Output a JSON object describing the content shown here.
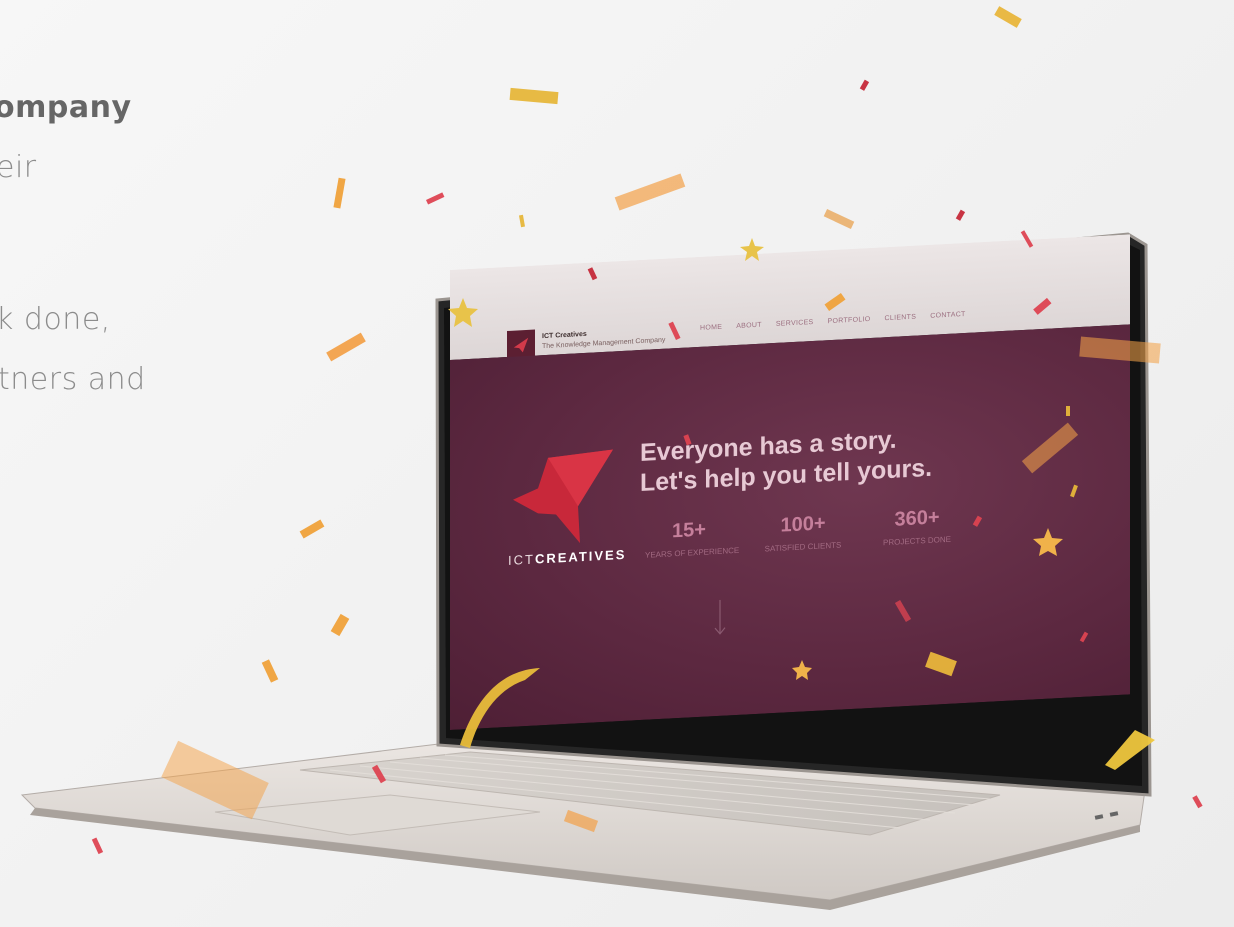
{
  "side_copy": {
    "line1": "ompany",
    "line2": "eir",
    "line3": "k done,",
    "line4": "tners and"
  },
  "laptop_screen": {
    "site": {
      "brand_name": "ICT Creatives",
      "tagline": "The Knowledge Management Company",
      "nav": [
        {
          "label": "HOME"
        },
        {
          "label": "ABOUT"
        },
        {
          "label": "SERVICES"
        },
        {
          "label": "PORTFOLIO"
        },
        {
          "label": "CLIENTS"
        },
        {
          "label": "CONTACT"
        }
      ],
      "hero": {
        "logo_text_light": "ICT",
        "logo_text_bold": "CREATIVES",
        "headline_line1": "Everyone has a story.",
        "headline_line2": "Let's help you tell yours.",
        "stats": [
          {
            "value": "15+",
            "label": "YEARS OF EXPERIENCE"
          },
          {
            "value": "100+",
            "label": "SATISFIED CLIENTS"
          },
          {
            "value": "360+",
            "label": "PROJECTS DONE"
          }
        ]
      }
    }
  },
  "colors": {
    "brand_maroon": "#5c2840",
    "brand_red": "#c8283a",
    "confetti_gold": "#e6b73a"
  },
  "icons": [
    "bird-logo-icon",
    "arrow-down-icon",
    "star-icon"
  ]
}
